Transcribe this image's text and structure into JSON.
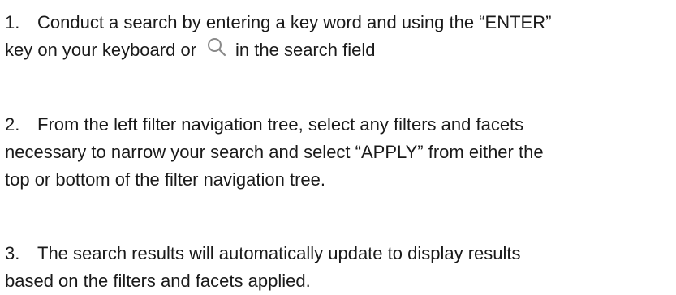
{
  "steps": [
    {
      "number": "1.",
      "line1": "Conduct a search by entering a key word and using the “ENTER”",
      "line2_before": "key on your keyboard or",
      "icon": "search-icon",
      "line2_after": "in the search field"
    },
    {
      "number": "2.",
      "line1": "From the left filter navigation tree, select any filters and facets",
      "line2": "necessary to narrow your search and select “APPLY” from either the",
      "line3": "top or bottom of the filter navigation tree."
    },
    {
      "number": "3.",
      "line1": "The search results will automatically update to display results",
      "line2": "based on the filters and facets applied."
    }
  ]
}
